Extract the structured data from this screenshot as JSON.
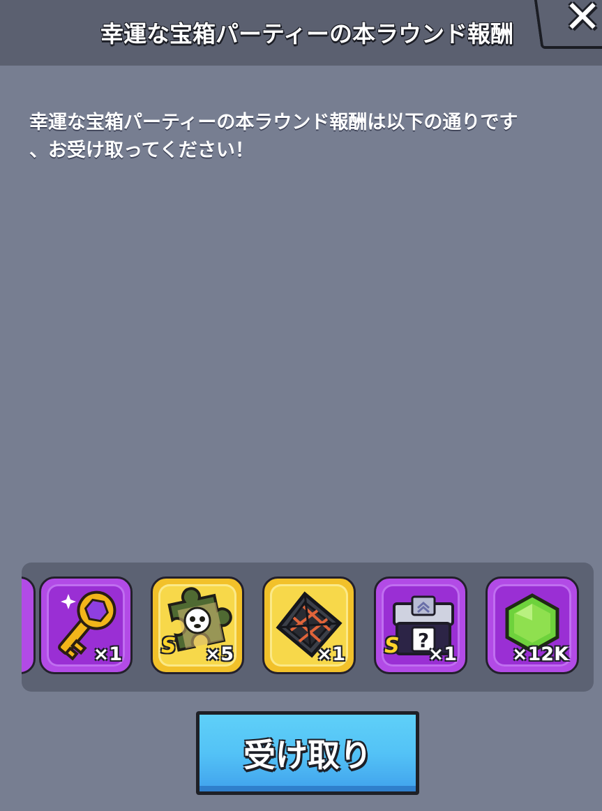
{
  "header": {
    "title": "幸運な宝箱パーティーの本ラウンド報酬"
  },
  "message": {
    "line1": "幸運な宝箱パーティーの本ラウンド報酬は以下の通りです",
    "line2": "、お受け取ってください！"
  },
  "rewards": [
    {
      "name": "golden-key",
      "icon": "key-icon",
      "frame": "purple",
      "count": "×1"
    },
    {
      "name": "pet-puzzle-piece",
      "icon": "puzzle-piece-icon",
      "frame": "gold",
      "grade": "S",
      "count": "×5"
    },
    {
      "name": "cage-cube",
      "icon": "cube-frame-icon",
      "frame": "gold",
      "count": "×1"
    },
    {
      "name": "mystery-chest",
      "icon": "mystery-chest-icon",
      "frame": "purple",
      "grade": "S",
      "count": "×1"
    },
    {
      "name": "green-gem",
      "icon": "green-gem-icon",
      "frame": "purple",
      "count": "×12K"
    }
  ],
  "claim_button": {
    "label": "受け取り"
  },
  "colors": {
    "background": "#777e91",
    "header": "#5b6070",
    "tray": "#5c6273",
    "purple_frame": "#b24be6",
    "gold_frame": "#f2c12a",
    "button": "#53c2f6"
  }
}
